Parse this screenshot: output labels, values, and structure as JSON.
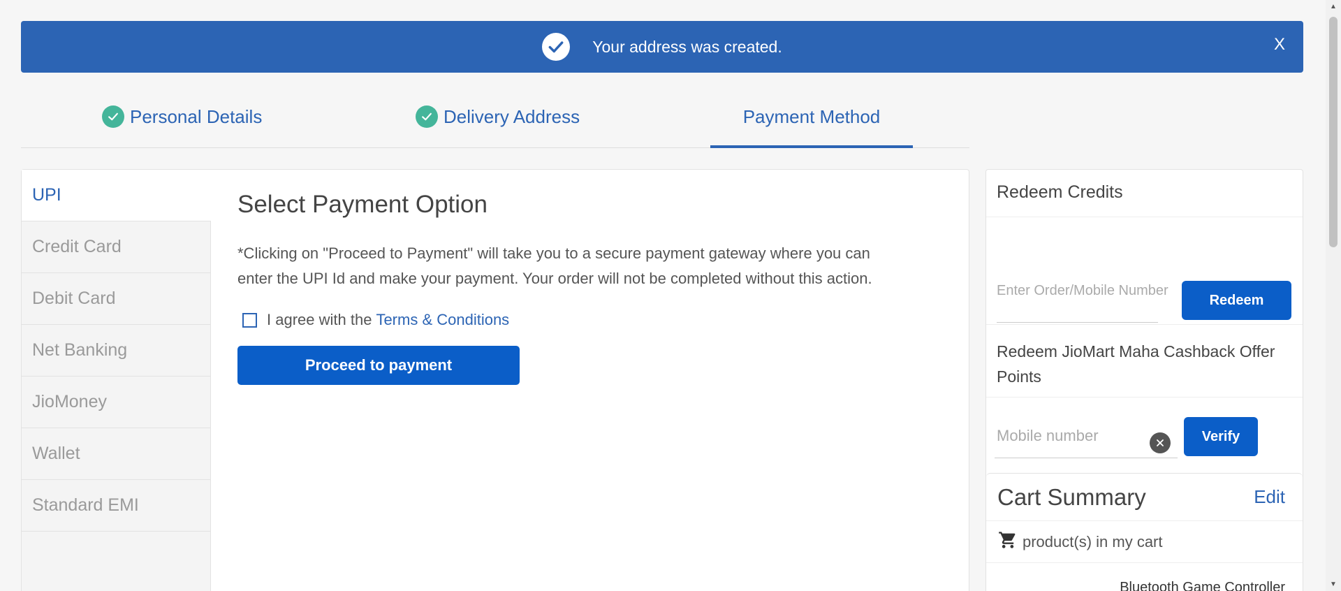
{
  "toast": {
    "message": "Your address was created.",
    "close_label": "X"
  },
  "stepper": {
    "steps": [
      {
        "label": "Personal Details",
        "status": "done"
      },
      {
        "label": "Delivery Address",
        "status": "done"
      },
      {
        "label": "Payment Method",
        "status": "active"
      }
    ]
  },
  "payment_methods": [
    "UPI",
    "Credit Card",
    "Debit Card",
    "Net Banking",
    "JioMoney",
    "Wallet",
    "Standard EMI"
  ],
  "content": {
    "title": "Select Payment Option",
    "description_line1": "*Clicking on \"Proceed to Payment\" will take you to a secure payment gateway where you can",
    "description_line2": "enter the UPI Id and make your payment. Your order will not be completed without this action.",
    "agree_text": "I agree with the",
    "terms_link": "Terms & Conditions",
    "proceed_label": "Proceed to payment"
  },
  "redeem": {
    "title": "Redeem Credits",
    "button_label": "Redeem",
    "placeholder": "Enter Order/Mobile Number",
    "maha_text": "Redeem JioMart Maha Cashback Offer Points",
    "mobile_placeholder": "Mobile number",
    "verify_label": "Verify"
  },
  "cart": {
    "title": "Cart Summary",
    "edit_label": "Edit",
    "count_text": "product(s) in my cart",
    "item": "Bluetooth Game Controller"
  },
  "colors": {
    "primary": "#2c64b4",
    "button": "#0b5ec8",
    "success": "#44b59a"
  }
}
